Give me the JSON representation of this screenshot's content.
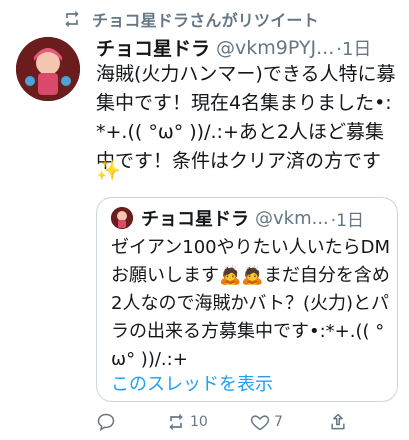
{
  "retweet_banner": {
    "text": "チョコ星ドラさんがリツイート",
    "icon": "retweet-icon"
  },
  "tweet": {
    "author_name": "チョコ星ドラ",
    "handle": "@vkm9PYJ...",
    "time": "·1日",
    "body": "海賊(火力ハンマー)できる人特に募集中です！現在4名集まりました•:*+.(( °ω° ))/.:+あと2人ほど募集中です！条件はクリア済の方です",
    "emoji": "✨"
  },
  "quoted_tweet": {
    "author_name": "チョコ星ドラ",
    "handle": "@vkm...",
    "time": "·1日",
    "body": "ゼイアン100やりたい人いたらDMお願いします🙇🙇まだ自分を含め2人なので海賊かバト？(火力)とパラの出来る方募集中です•:*+.(( °ω° ))/.:+",
    "show_thread": "このスレッドを表示"
  },
  "actions": {
    "reply_icon": "reply-icon",
    "retweet_count": "10",
    "like_count": "7",
    "share_icon": "share-icon"
  },
  "colors": {
    "accent": "#1da1f2",
    "muted": "#657786",
    "border": "#ccd6dd"
  }
}
